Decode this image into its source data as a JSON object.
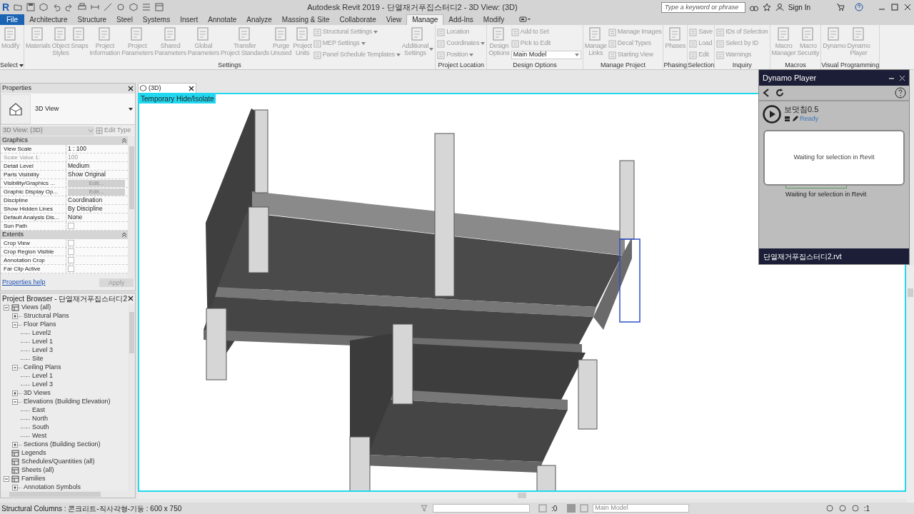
{
  "title_bar": {
    "logo": "R",
    "title": "Autodesk Revit 2019 - 단열재거푸집스터디2 - 3D View: (3D)",
    "search_placeholder": "Type a keyword or phrase",
    "sign_in": "Sign In"
  },
  "tabs": [
    {
      "label": "File",
      "kind": "file",
      "selected": false
    },
    {
      "label": "Architecture",
      "kind": "tab",
      "selected": false
    },
    {
      "label": "Structure",
      "kind": "tab",
      "selected": false
    },
    {
      "label": "Steel",
      "kind": "tab",
      "selected": false
    },
    {
      "label": "Systems",
      "kind": "tab",
      "selected": false
    },
    {
      "label": "Insert",
      "kind": "tab",
      "selected": false
    },
    {
      "label": "Annotate",
      "kind": "tab",
      "selected": false
    },
    {
      "label": "Analyze",
      "kind": "tab",
      "selected": false
    },
    {
      "label": "Massing & Site",
      "kind": "tab",
      "selected": false
    },
    {
      "label": "Collaborate",
      "kind": "tab",
      "selected": false
    },
    {
      "label": "View",
      "kind": "tab",
      "selected": false
    },
    {
      "label": "Manage",
      "kind": "tab",
      "selected": true
    },
    {
      "label": "Add-Ins",
      "kind": "tab",
      "selected": false
    },
    {
      "label": "Modify",
      "kind": "tab",
      "selected": false
    }
  ],
  "ribbon": {
    "disabled": true,
    "panels": [
      {
        "label": "Select",
        "menu": true,
        "columns": [
          {
            "kind": "large",
            "label": "Modify"
          }
        ]
      },
      {
        "label": "Settings",
        "columns": [
          {
            "kind": "large",
            "label": "Materials"
          },
          {
            "kind": "large",
            "label": "Object\nStyles"
          },
          {
            "kind": "large",
            "label": "Snaps"
          },
          {
            "kind": "large",
            "label": "Project\nInformation"
          },
          {
            "kind": "large",
            "label": "Project\nParameters"
          },
          {
            "kind": "large",
            "label": "Shared\nParameters"
          },
          {
            "kind": "large",
            "label": "Global\nParameters"
          },
          {
            "kind": "large",
            "label": "Transfer\nProject Standards"
          },
          {
            "kind": "large",
            "label": "Purge\nUnused"
          },
          {
            "kind": "large",
            "label": "Project\nUnits"
          },
          {
            "kind": "stack",
            "items": [
              {
                "kind": "small",
                "label": "Structural Settings",
                "menu": true
              },
              {
                "kind": "small",
                "label": "MEP Settings",
                "menu": true
              },
              {
                "kind": "small",
                "label": "Panel Schedule Templates",
                "menu": true
              }
            ]
          },
          {
            "kind": "large",
            "label": "Additional\nSettings",
            "menu": true
          }
        ]
      },
      {
        "label": "Project Location",
        "columns": [
          {
            "kind": "stack",
            "items": [
              {
                "kind": "small",
                "label": "Location"
              },
              {
                "kind": "small",
                "label": "Coordinates",
                "menu": true
              },
              {
                "kind": "small",
                "label": "Position",
                "menu": true
              }
            ]
          }
        ]
      },
      {
        "label": "Design Options",
        "columns": [
          {
            "kind": "large",
            "label": "Design\nOptions"
          },
          {
            "kind": "stack",
            "items": [
              {
                "kind": "small",
                "label": "Add to Set"
              },
              {
                "kind": "small",
                "label": "Pick to Edit"
              },
              {
                "kind": "select",
                "label": "Main Model",
                "menu": true
              }
            ]
          }
        ]
      },
      {
        "label": "Manage Project",
        "columns": [
          {
            "kind": "large",
            "label": "Manage\nLinks"
          },
          {
            "kind": "stack",
            "items": [
              {
                "kind": "small",
                "label": "Manage Images"
              },
              {
                "kind": "small",
                "label": "Decal Types"
              },
              {
                "kind": "small",
                "label": "Starting View"
              }
            ]
          }
        ]
      },
      {
        "label": "Phasing",
        "columns": [
          {
            "kind": "large",
            "label": "Phases"
          }
        ]
      },
      {
        "label": "Selection",
        "columns": [
          {
            "kind": "stack",
            "items": [
              {
                "kind": "small",
                "label": "Save"
              },
              {
                "kind": "small",
                "label": "Load"
              },
              {
                "kind": "small",
                "label": "Edit"
              }
            ]
          }
        ]
      },
      {
        "label": "Inquiry",
        "columns": [
          {
            "kind": "stack",
            "items": [
              {
                "kind": "small",
                "label": "IDs of Selection"
              },
              {
                "kind": "small",
                "label": "Select by ID"
              },
              {
                "kind": "small",
                "label": "Warnings"
              }
            ]
          }
        ]
      },
      {
        "label": "Macros",
        "columns": [
          {
            "kind": "large",
            "label": "Macro\nManager"
          },
          {
            "kind": "large",
            "label": "Macro\nSecurity"
          }
        ]
      },
      {
        "label": "Visual Programming",
        "columns": [
          {
            "kind": "large",
            "label": "Dynamo"
          },
          {
            "kind": "large",
            "label": "Dynamo\nPlayer"
          }
        ]
      }
    ]
  },
  "properties": {
    "title": "Properties",
    "type_name": "3D View",
    "instance_selector": "3D View: (3D)",
    "edit_type": "Edit Type",
    "groups": [
      {
        "label": "Graphics",
        "rows": [
          {
            "name": "View Scale",
            "kind": "text",
            "value": "1 : 100"
          },
          {
            "name": "Scale Value    1:",
            "kind": "readonly",
            "value": "100"
          },
          {
            "name": "Detail Level",
            "kind": "text",
            "value": "Medium"
          },
          {
            "name": "Parts Visibility",
            "kind": "text",
            "value": "Show Original"
          },
          {
            "name": "Visibility/Graphics ...",
            "kind": "button",
            "value": "Edit..."
          },
          {
            "name": "Graphic Display Op...",
            "kind": "button",
            "value": "Edit..."
          },
          {
            "name": "Discipline",
            "kind": "text",
            "value": "Coordination"
          },
          {
            "name": "Show Hidden Lines",
            "kind": "text",
            "value": "By Discipline"
          },
          {
            "name": "Default Analysis Dis...",
            "kind": "text",
            "value": "None"
          },
          {
            "name": "Sun Path",
            "kind": "check",
            "checked": false
          }
        ]
      },
      {
        "label": "Extents",
        "rows": [
          {
            "name": "Crop View",
            "kind": "check",
            "checked": false
          },
          {
            "name": "Crop Region Visible",
            "kind": "check",
            "checked": false
          },
          {
            "name": "Annotation Crop",
            "kind": "check",
            "checked": false
          },
          {
            "name": "Far Clip Active",
            "kind": "check",
            "checked": false
          }
        ]
      }
    ],
    "help_link": "Properties help",
    "apply": "Apply"
  },
  "project_browser": {
    "title": "Project Browser - 단열재거푸집스터디2",
    "tree": [
      {
        "label": "Views (all)",
        "expanded": true,
        "children": [
          {
            "label": "Structural Plans",
            "expanded": false
          },
          {
            "label": "Floor Plans",
            "expanded": true,
            "children": [
              {
                "label": "Level2"
              },
              {
                "label": "Level 1"
              },
              {
                "label": "Level 3"
              },
              {
                "label": "Site"
              }
            ]
          },
          {
            "label": "Ceiling Plans",
            "expanded": true,
            "children": [
              {
                "label": "Level 1"
              },
              {
                "label": "Level 3"
              }
            ]
          },
          {
            "label": "3D Views",
            "expanded": false
          },
          {
            "label": "Elevations (Building Elevation)",
            "expanded": true,
            "children": [
              {
                "label": "East"
              },
              {
                "label": "North"
              },
              {
                "label": "South"
              },
              {
                "label": "West"
              }
            ]
          },
          {
            "label": "Sections (Building Section)",
            "expanded": false
          }
        ]
      },
      {
        "label": "Legends"
      },
      {
        "label": "Schedules/Quantities (all)"
      },
      {
        "label": "Sheets (all)"
      },
      {
        "label": "Families",
        "expanded": true,
        "children": [
          {
            "label": "Annotation Symbols",
            "expanded": false
          }
        ]
      }
    ]
  },
  "view_tab": {
    "label": "(3D)"
  },
  "viewport": {
    "banner": "Temporary Hide/Isolate"
  },
  "dynamo_player": {
    "title": "Dynamo Player",
    "script": {
      "name": "보덧침0.5",
      "status": "Ready"
    },
    "dialog": "Waiting for selection in Revit",
    "message": "Waiting for selection in Revit",
    "file": "단열재거푸집스터디2.rvt"
  },
  "status_bar": {
    "selection": "Structural Columns : 콘크리트-직사각형-기둥 : 600 x 750",
    "count_left": ":0",
    "design_option": "Main Model",
    "count_right": ":1"
  }
}
